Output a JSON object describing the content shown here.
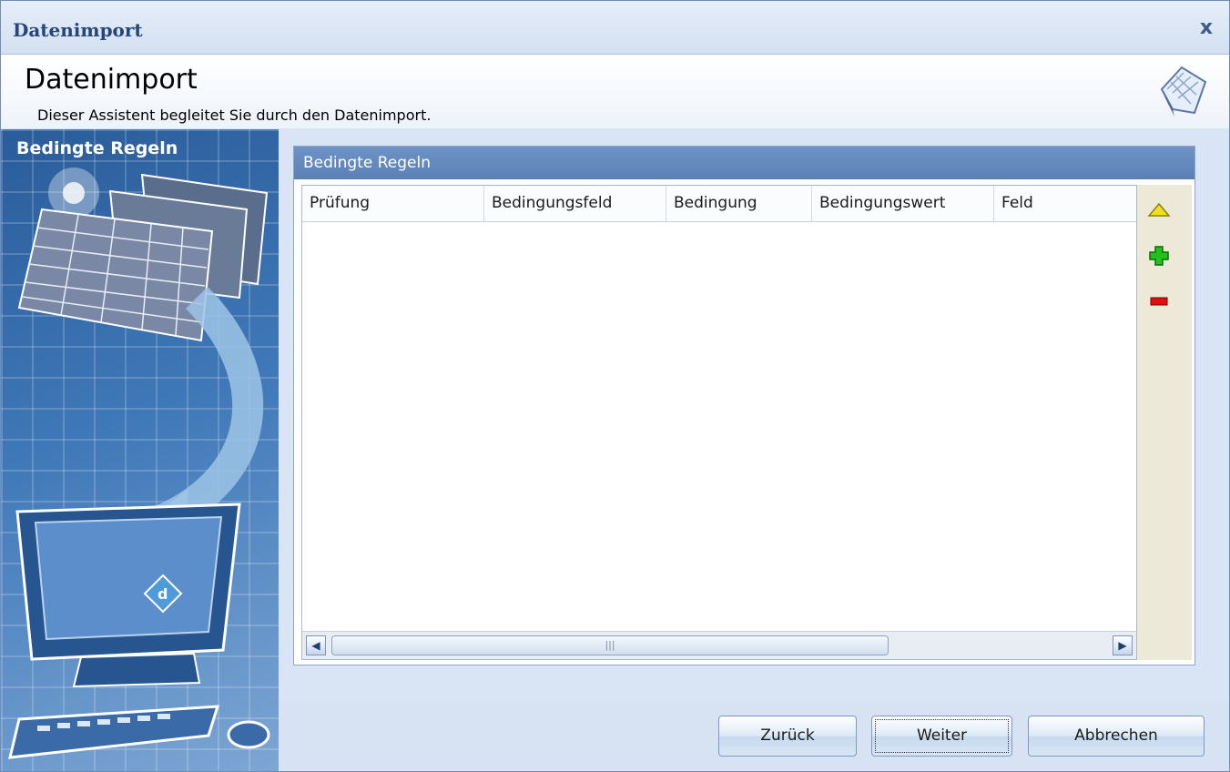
{
  "window": {
    "title": "Datenimport",
    "close_label": "x"
  },
  "header": {
    "title": "Datenimport",
    "subtitle": "Dieser Assistent begleitet Sie durch den Datenimport."
  },
  "sidebar": {
    "title": "Bedingte Regeln"
  },
  "panel": {
    "title": "Bedingte Regeln",
    "columns": [
      "Prüfung",
      "Bedingungsfeld",
      "Bedingung",
      "Bedingungswert",
      "Feld"
    ],
    "rows": []
  },
  "toolbar": {
    "icons": [
      "move-up-icon",
      "add-icon",
      "remove-icon"
    ]
  },
  "buttons": {
    "back": "Zurück",
    "next": "Weiter",
    "cancel": "Abbrechen"
  },
  "colors": {
    "panel_header": "#5a80b6",
    "add": "#22c21a",
    "remove": "#e01010",
    "up": "#f0e020"
  }
}
